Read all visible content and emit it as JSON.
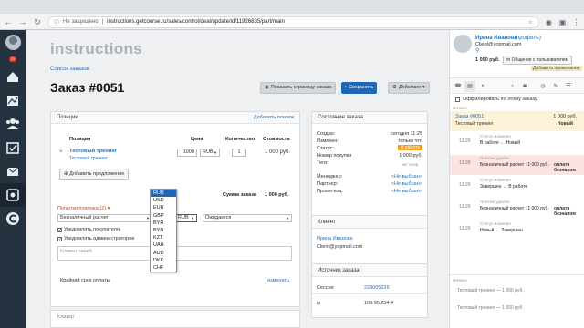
{
  "browser": {
    "security_label": "Не защищено",
    "url": "instructions.getcourse.ru/sales/control/deal/update/id/11926835/part/main"
  },
  "sidebar": {
    "badge": "21"
  },
  "brand": "instructions",
  "breadcrumb": "Список заказов",
  "order_title": "Заказ #0051",
  "toolbar": {
    "show_page": "Показать страницу заказа",
    "save": "Сохранить",
    "actions": "Действия"
  },
  "positions": {
    "title": "Позиции",
    "add_payment": "Добавить платеж",
    "headers": {
      "position": "Позиция",
      "price": "Цена",
      "quantity": "Количество",
      "cost": "Стоимость"
    },
    "item": {
      "name": "Тестовый тренинг",
      "sub": "Тестовый тренинг",
      "price": "1000",
      "currency": "RUB",
      "qty": "1",
      "cost": "1 000 руб."
    },
    "add_offer": "Добавить предложение",
    "order_sum_label": "Сумма заказа",
    "order_sum": "1 000 руб.",
    "attempts_label": "Попытки платежа (2)",
    "payment": {
      "method": "Безналичный расчет",
      "amount": "1000",
      "currency": "RUB",
      "status": "Ожидается"
    },
    "notify_buyer": "Уведомлять покупателя",
    "notify_admins": "Уведомлять администраторов",
    "comment_placeholder": "Комментарий",
    "deadline_label": "Крайний срок оплаты",
    "change": "изменить",
    "bottom_label": "Кликер"
  },
  "currency_options": [
    "RUB",
    "USD",
    "EUR",
    "GBP",
    "BYR",
    "BYN",
    "KZT",
    "UAH",
    "AUD",
    "DKK",
    "CHF"
  ],
  "order_state": {
    "title": "Состояние заказа",
    "created_label": "Создан:",
    "created": "сегодня 11:25",
    "changed_label": "Изменен:",
    "changed": "только что",
    "status_label": "Статус:",
    "status": "В работе",
    "purchases_label": "Номер покупки",
    "purchases": "1 000 руб.",
    "tags_label": "Теги:",
    "tags": "нет тегов",
    "manager_label": "Менеджер:",
    "manager": "<Не выбран>",
    "partner_label": "Партнер:",
    "partner": "<Не выбран>",
    "promo_label": "Промо-код:",
    "promo": "<Не выбран>"
  },
  "client": {
    "title": "Клиент",
    "name": "Ирина Иванова",
    "email": "Client@yopmail.com"
  },
  "source": {
    "title": "Источник заказа",
    "session_label": "Сессия",
    "session": "229005226",
    "ip_label": "ip",
    "ip": "109.95.254.4",
    "next_label": "Начало"
  },
  "right_panel": {
    "user_name": "Ирина Иванова",
    "profile": "(профиль)",
    "email": "Client@yopmail.com",
    "amount": "1 000 руб.",
    "chat_btn": "Общение с пользователем",
    "add_note": "Добавить примечание",
    "subscribe": "Оффилировать по этому заказу",
    "section_label": "Начало",
    "order_ref": "Заказ #0051",
    "order_sum": "1 000 руб.",
    "order_sub": "Тестовый тренинг",
    "order_state": "Новый",
    "events": [
      {
        "time": "13:29",
        "title": "Статус изменен",
        "text": "В работе ← Новый",
        "highlight": false
      },
      {
        "time": "13:29",
        "title": "Платеж удален",
        "text": "Безналичный расчет : 1 000 руб.",
        "extra": "оплата безналом",
        "highlight": true
      },
      {
        "time": "13:29",
        "title": "Статус изменен",
        "text": "Завершен ← В работе",
        "highlight": false
      },
      {
        "time": "13:29",
        "title": "Платеж удален",
        "text": "Безналичный расчет : 1 000 руб.",
        "extra": "оплата безналом",
        "highlight": false
      },
      {
        "time": "13:29",
        "title": "Статус изменен",
        "text": "Новый ← Завершен",
        "highlight": false
      }
    ],
    "footer_rows": [
      "Тестовый тренинг — 1 000 руб.",
      "Тестовый тренинг — 1 000 руб."
    ],
    "footer_label": "Начало"
  }
}
